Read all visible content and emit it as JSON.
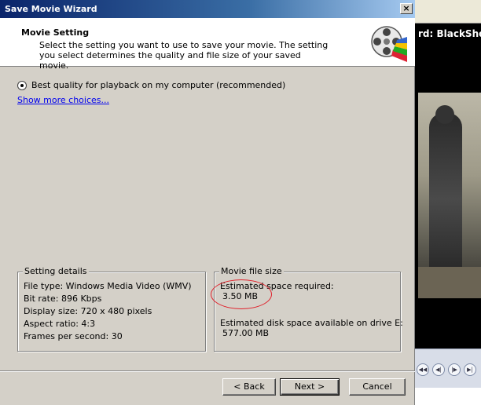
{
  "window": {
    "title": "Save Movie Wizard",
    "close_label": "×"
  },
  "header": {
    "title": "Movie Setting",
    "description": "Select the setting you want to use to save your movie. The setting you select determines the quality and file size of your saved movie.",
    "icon": "film-reel-icon"
  },
  "options": {
    "best_quality_label": "Best quality for playback on my computer (recommended)",
    "show_more_label": "Show more choices..."
  },
  "setting_details": {
    "label": "Setting details",
    "file_type": "File type: Windows Media Video (WMV)",
    "bit_rate": "Bit rate: 896 Kbps",
    "display_size": "Display size: 720 x 480 pixels",
    "aspect_ratio": "Aspect ratio: 4:3",
    "fps": "Frames per second: 30"
  },
  "movie_file_size": {
    "label": "Movie file size",
    "estimated_space_label": "Estimated space required:",
    "estimated_space_value": "3.50 MB",
    "disk_space_label": "Estimated disk space available on drive E:",
    "disk_space_value": "577.00 MB"
  },
  "buttons": {
    "back": "< Back",
    "next": "Next >",
    "cancel": "Cancel"
  },
  "background_app": {
    "title_fragment": "rd: BlackShot"
  },
  "colors": {
    "titlebar": "#0a246a",
    "link": "#0000ee",
    "annotation": "#e0202a"
  }
}
